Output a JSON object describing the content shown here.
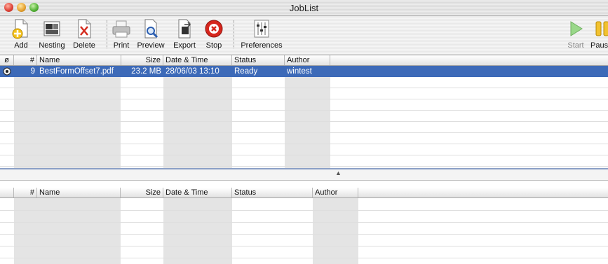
{
  "window": {
    "title": "JobList"
  },
  "toolbar": {
    "add": "Add",
    "nesting": "Nesting",
    "delete": "Delete",
    "print": "Print",
    "preview": "Preview",
    "export": "Export",
    "stop": "Stop",
    "preferences": "Preferences",
    "start": "Start",
    "pause": "Paus"
  },
  "top_table": {
    "headers": {
      "icon": "ø",
      "num": "#",
      "name": "Name",
      "size": "Size",
      "datetime": "Date & Time",
      "status": "Status",
      "author": "Author"
    },
    "rows": [
      {
        "num": "9",
        "name": "BestFormOffset7.pdf",
        "size": "23.2 MB",
        "datetime": "28/06/03 13:10",
        "status": "Ready",
        "author": "wintest",
        "selected": true
      }
    ]
  },
  "bottom_table": {
    "headers": {
      "num": "#",
      "name": "Name",
      "size": "Size",
      "datetime": "Date & Time",
      "status": "Status",
      "author": "Author"
    },
    "rows": []
  },
  "colors": {
    "selection": "#3d6ab8",
    "splitter": "#8a9fc6"
  },
  "icons": {
    "add": "add-document-icon",
    "nesting": "nesting-icon",
    "delete": "delete-document-icon",
    "print": "printer-icon",
    "preview": "preview-magnifier-icon",
    "export": "export-icon",
    "stop": "stop-icon",
    "preferences": "sliders-icon",
    "start": "play-icon",
    "pause": "pause-icon"
  }
}
